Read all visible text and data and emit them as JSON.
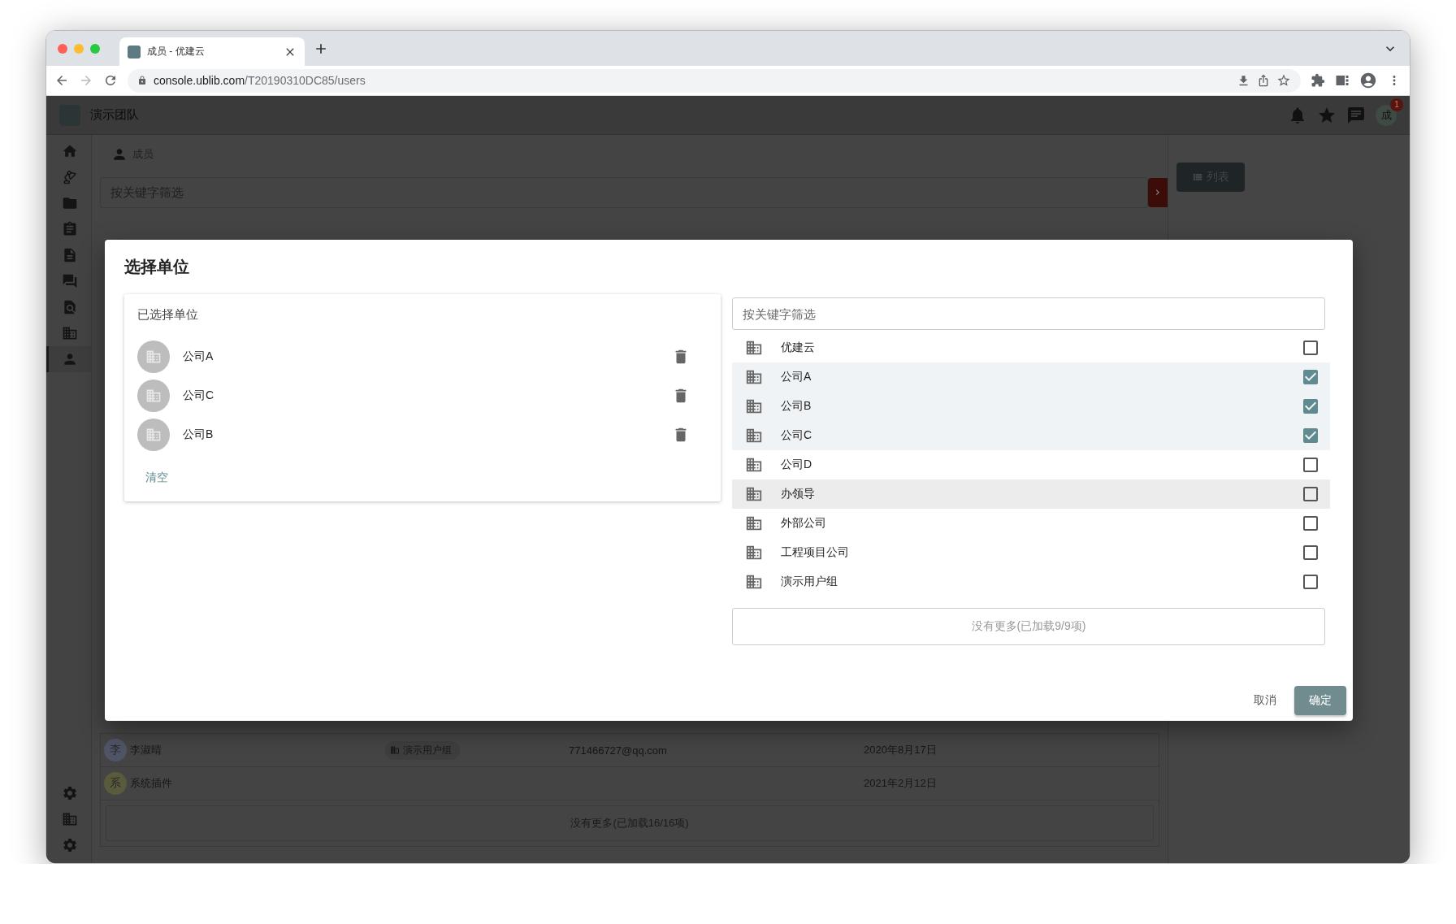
{
  "browser": {
    "tab_title": "成员 - 优建云",
    "url_host": "console.ublib.com",
    "url_path": "/T20190310DC85/users"
  },
  "app": {
    "team": "演示团队",
    "notification_badge": "1",
    "avatar_initial": "成"
  },
  "sidebar": {
    "top": [
      {
        "kind": "home",
        "selected": false
      },
      {
        "kind": "lamp",
        "selected": false
      },
      {
        "kind": "folder",
        "selected": false
      },
      {
        "kind": "clipboard",
        "selected": false
      },
      {
        "kind": "file",
        "selected": false
      },
      {
        "kind": "chat",
        "selected": false
      },
      {
        "kind": "search",
        "selected": false
      },
      {
        "kind": "building",
        "selected": false
      },
      {
        "kind": "person",
        "selected": true
      }
    ],
    "bottom": [
      {
        "kind": "gear"
      },
      {
        "kind": "building"
      },
      {
        "kind": "gear"
      }
    ]
  },
  "page": {
    "breadcrumb": "成员",
    "filter_placeholder": "按关键字筛选",
    "view_button": "列表",
    "rows": [
      {
        "avatar": "李",
        "color": "#4f5566",
        "name": "李淑晴",
        "unit": "演示用户组",
        "email": "771466727@qq.com",
        "date": "2020年8月17日"
      },
      {
        "avatar": "系",
        "color": "#5a5a3c",
        "name": "系统插件",
        "date": "2021年2月12日"
      }
    ],
    "footer": "没有更多(已加载16/16项)"
  },
  "dialog": {
    "title": "选择单位",
    "selected_heading": "已选择单位",
    "selected_units": [
      {
        "name": "公司A"
      },
      {
        "name": "公司C"
      },
      {
        "name": "公司B"
      }
    ],
    "clear": "清空",
    "filter_placeholder": "按关键字筛选",
    "units": [
      {
        "name": "优建云",
        "checked": false,
        "hovered": false
      },
      {
        "name": "公司A",
        "checked": true,
        "hovered": false
      },
      {
        "name": "公司B",
        "checked": true,
        "hovered": false
      },
      {
        "name": "公司C",
        "checked": true,
        "hovered": false
      },
      {
        "name": "公司D",
        "checked": false,
        "hovered": false
      },
      {
        "name": "办领导",
        "checked": false,
        "hovered": true
      },
      {
        "name": "外部公司",
        "checked": false,
        "hovered": false
      },
      {
        "name": "工程项目公司",
        "checked": false,
        "hovered": false
      },
      {
        "name": "演示用户组",
        "checked": false,
        "hovered": false
      }
    ],
    "footer": "没有更多(已加载9/9项)",
    "cancel": "取消",
    "confirm": "确定"
  }
}
